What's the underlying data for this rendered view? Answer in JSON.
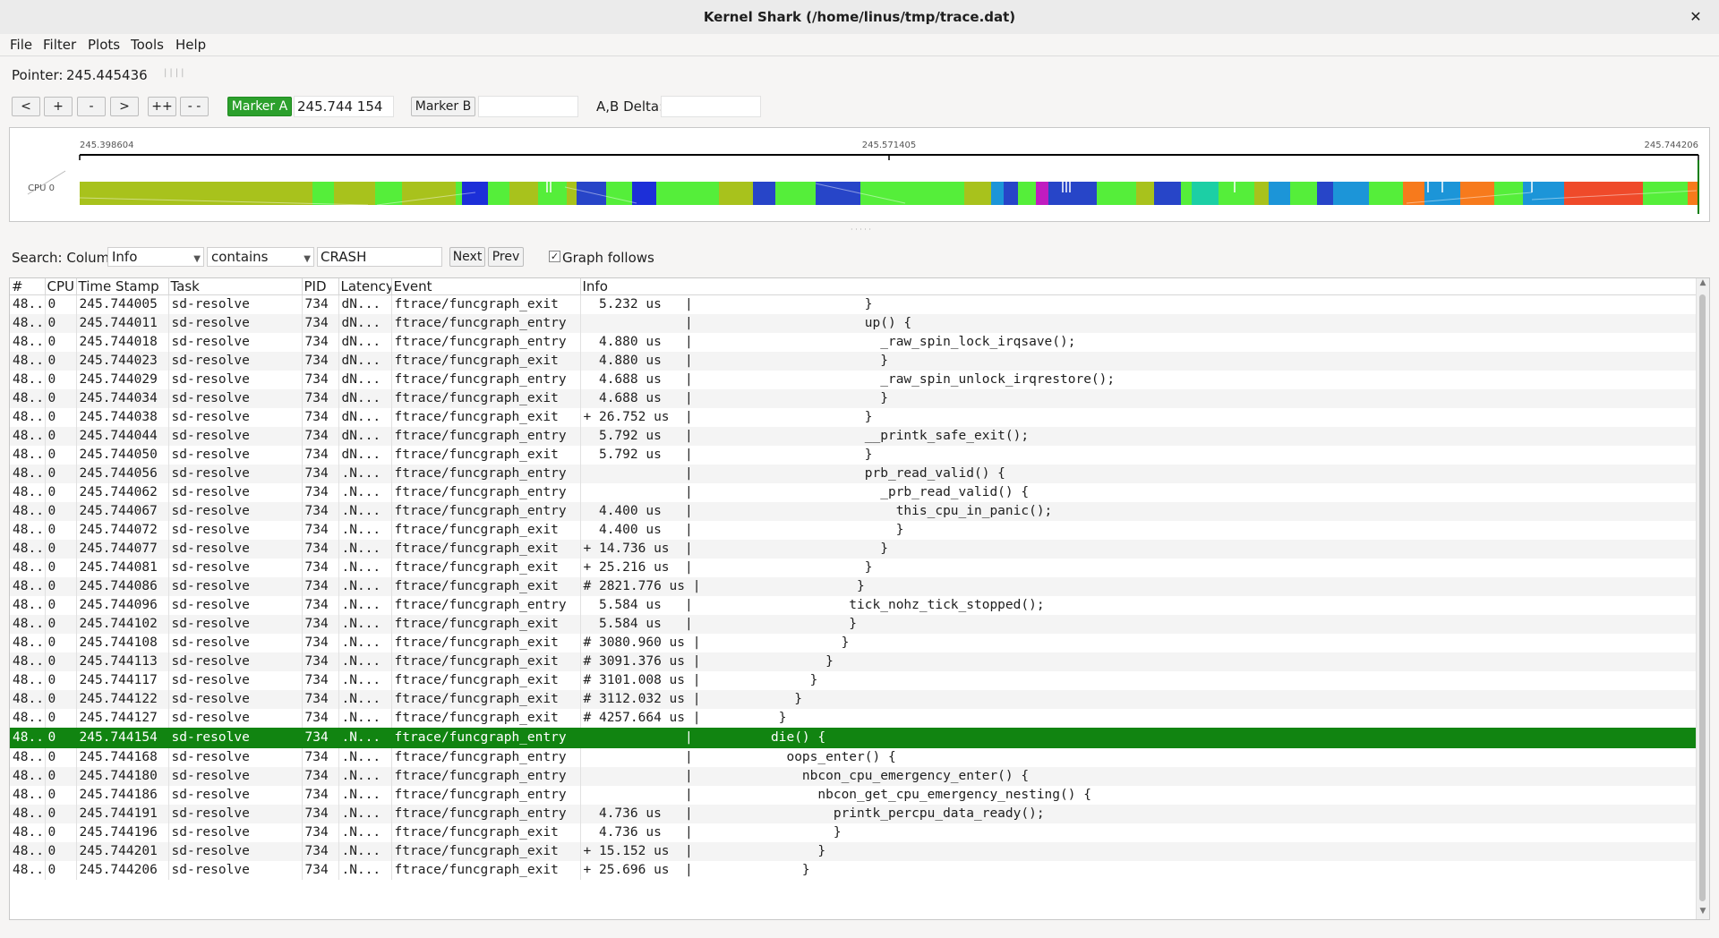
{
  "window": {
    "title": "Kernel Shark (/home/linus/tmp/trace.dat)",
    "close_icon": "close-icon"
  },
  "menu": [
    "File",
    "Filter",
    "Plots",
    "Tools",
    "Help"
  ],
  "pointer": {
    "label": "Pointer:",
    "value": "245.445436"
  },
  "nav_buttons": [
    "<",
    "+",
    "-",
    ">",
    "++",
    "- -"
  ],
  "markers": {
    "a_label": "Marker A",
    "a_value": "245.744 154",
    "b_label": "Marker B",
    "b_value": "",
    "delta_label": "A,B Delta:",
    "delta_value": ""
  },
  "graph": {
    "ticks": [
      "245.398604",
      "245.571405",
      "245.744206"
    ],
    "cpu_label": "CPU 0",
    "colors": {
      "olive": "#a8c21c",
      "blue": "#1c2fd8",
      "green": "#55ee3a",
      "teal": "#1ccfa5",
      "navy": "#2745c8",
      "magenta": "#c01cc0",
      "sky": "#1c95d8",
      "orange": "#f77a1c",
      "red": "#ef4a2a"
    }
  },
  "search": {
    "label": "Search: Column",
    "column": "Info",
    "mode": "contains",
    "value": "CRASH",
    "next": "Next",
    "prev": "Prev",
    "graph_follows": "Graph follows",
    "graph_follows_checked": true
  },
  "table": {
    "headers": [
      "#",
      "CPU",
      "Time Stamp",
      "Task",
      "PID",
      "Latency",
      "Event",
      "Info"
    ],
    "selected_row": 23,
    "rows": [
      [
        "48...",
        "0",
        "245.744005",
        "sd-resolve",
        "734",
        "dN...",
        "ftrace/funcgraph_exit",
        "  5.232 us   |                      }"
      ],
      [
        "48...",
        "0",
        "245.744011",
        "sd-resolve",
        "734",
        "dN...",
        "ftrace/funcgraph_entry",
        "             |                      up() {"
      ],
      [
        "48...",
        "0",
        "245.744018",
        "sd-resolve",
        "734",
        "dN...",
        "ftrace/funcgraph_entry",
        "  4.880 us   |                        _raw_spin_lock_irqsave();"
      ],
      [
        "48...",
        "0",
        "245.744023",
        "sd-resolve",
        "734",
        "dN...",
        "ftrace/funcgraph_exit",
        "  4.880 us   |                        }"
      ],
      [
        "48...",
        "0",
        "245.744029",
        "sd-resolve",
        "734",
        "dN...",
        "ftrace/funcgraph_entry",
        "  4.688 us   |                        _raw_spin_unlock_irqrestore();"
      ],
      [
        "48...",
        "0",
        "245.744034",
        "sd-resolve",
        "734",
        "dN...",
        "ftrace/funcgraph_exit",
        "  4.688 us   |                        }"
      ],
      [
        "48...",
        "0",
        "245.744038",
        "sd-resolve",
        "734",
        "dN...",
        "ftrace/funcgraph_exit",
        "+ 26.752 us  |                      }"
      ],
      [
        "48...",
        "0",
        "245.744044",
        "sd-resolve",
        "734",
        "dN...",
        "ftrace/funcgraph_entry",
        "  5.792 us   |                      __printk_safe_exit();"
      ],
      [
        "48...",
        "0",
        "245.744050",
        "sd-resolve",
        "734",
        "dN...",
        "ftrace/funcgraph_exit",
        "  5.792 us   |                      }"
      ],
      [
        "48...",
        "0",
        "245.744056",
        "sd-resolve",
        "734",
        ".N...",
        "ftrace/funcgraph_entry",
        "             |                      prb_read_valid() {"
      ],
      [
        "48...",
        "0",
        "245.744062",
        "sd-resolve",
        "734",
        ".N...",
        "ftrace/funcgraph_entry",
        "             |                        _prb_read_valid() {"
      ],
      [
        "48...",
        "0",
        "245.744067",
        "sd-resolve",
        "734",
        ".N...",
        "ftrace/funcgraph_entry",
        "  4.400 us   |                          this_cpu_in_panic();"
      ],
      [
        "48...",
        "0",
        "245.744072",
        "sd-resolve",
        "734",
        ".N...",
        "ftrace/funcgraph_exit",
        "  4.400 us   |                          }"
      ],
      [
        "48...",
        "0",
        "245.744077",
        "sd-resolve",
        "734",
        ".N...",
        "ftrace/funcgraph_exit",
        "+ 14.736 us  |                        }"
      ],
      [
        "48...",
        "0",
        "245.744081",
        "sd-resolve",
        "734",
        ".N...",
        "ftrace/funcgraph_exit",
        "+ 25.216 us  |                      }"
      ],
      [
        "48...",
        "0",
        "245.744086",
        "sd-resolve",
        "734",
        ".N...",
        "ftrace/funcgraph_exit",
        "# 2821.776 us |                    }"
      ],
      [
        "48...",
        "0",
        "245.744096",
        "sd-resolve",
        "734",
        ".N...",
        "ftrace/funcgraph_entry",
        "  5.584 us   |                    tick_nohz_tick_stopped();"
      ],
      [
        "48...",
        "0",
        "245.744102",
        "sd-resolve",
        "734",
        ".N...",
        "ftrace/funcgraph_exit",
        "  5.584 us   |                    }"
      ],
      [
        "48...",
        "0",
        "245.744108",
        "sd-resolve",
        "734",
        ".N...",
        "ftrace/funcgraph_exit",
        "# 3080.960 us |                  }"
      ],
      [
        "48...",
        "0",
        "245.744113",
        "sd-resolve",
        "734",
        ".N...",
        "ftrace/funcgraph_exit",
        "# 3091.376 us |                }"
      ],
      [
        "48...",
        "0",
        "245.744117",
        "sd-resolve",
        "734",
        ".N...",
        "ftrace/funcgraph_exit",
        "# 3101.008 us |              }"
      ],
      [
        "48...",
        "0",
        "245.744122",
        "sd-resolve",
        "734",
        ".N...",
        "ftrace/funcgraph_exit",
        "# 3112.032 us |            }"
      ],
      [
        "48...",
        "0",
        "245.744127",
        "sd-resolve",
        "734",
        ".N...",
        "ftrace/funcgraph_exit",
        "# 4257.664 us |          }"
      ],
      [
        "48...",
        "0",
        "245.744154",
        "sd-resolve",
        "734",
        ".N...",
        "ftrace/funcgraph_entry",
        "             |          die() {"
      ],
      [
        "48...",
        "0",
        "245.744168",
        "sd-resolve",
        "734",
        ".N...",
        "ftrace/funcgraph_entry",
        "             |            oops_enter() {"
      ],
      [
        "48...",
        "0",
        "245.744180",
        "sd-resolve",
        "734",
        ".N...",
        "ftrace/funcgraph_entry",
        "             |              nbcon_cpu_emergency_enter() {"
      ],
      [
        "48...",
        "0",
        "245.744186",
        "sd-resolve",
        "734",
        ".N...",
        "ftrace/funcgraph_entry",
        "             |                nbcon_get_cpu_emergency_nesting() {"
      ],
      [
        "48...",
        "0",
        "245.744191",
        "sd-resolve",
        "734",
        ".N...",
        "ftrace/funcgraph_entry",
        "  4.736 us   |                  printk_percpu_data_ready();"
      ],
      [
        "48...",
        "0",
        "245.744196",
        "sd-resolve",
        "734",
        ".N...",
        "ftrace/funcgraph_exit",
        "  4.736 us   |                  }"
      ],
      [
        "48...",
        "0",
        "245.744201",
        "sd-resolve",
        "734",
        ".N...",
        "ftrace/funcgraph_exit",
        "+ 15.152 us  |                }"
      ],
      [
        "48...",
        "0",
        "245.744206",
        "sd-resolve",
        "734",
        ".N...",
        "ftrace/funcgraph_exit",
        "+ 25.696 us  |              }"
      ]
    ]
  }
}
